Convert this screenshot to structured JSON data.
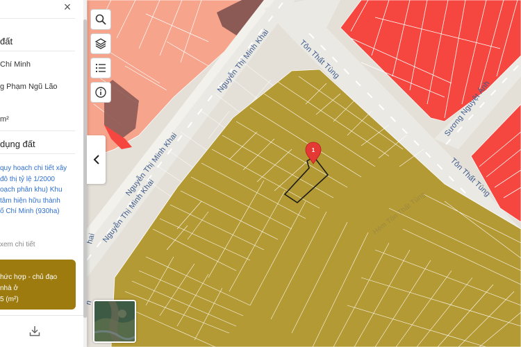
{
  "panel": {
    "close_symbol": "×",
    "section_heading_1": "đất",
    "city_partial": "Chí Minh",
    "ward_partial": "g Phạm Ngũ Lão",
    "area_unit": "m²",
    "section_heading_2": "dụng đất",
    "plan_lines": [
      "quy hoạch chi tiết xây",
      "đô thị tỷ lệ 1/2000",
      "oạch phân khu) Khu",
      "tâm hiện hữu thành",
      "ố Chí Minh (930ha)"
    ],
    "details_link": "xem chi tiết",
    "zone_lines": [
      "hức hợp - chủ đạo",
      "nhà ở",
      "5 (m²)"
    ],
    "download_icon": "download-icon"
  },
  "toolbar": {
    "icons": [
      "search-icon",
      "layers-icon",
      "list-icon",
      "info-icon"
    ],
    "collapse_icon": "chevron-left-icon"
  },
  "map": {
    "marker_label": "1",
    "roads": {
      "nguyen_thi_minh_khai_top": "Nguyễn Thị Minh Khai",
      "nguyen_thi_minh_khai_mid": "Nguyễn Thị Minh Khai",
      "nguyen_thi_minh_khai_low": "Nguyễn Thị Minh Khai",
      "ton_that_tung_top": "Tôn Thất Tùng",
      "ton_that_tung_right": "Tôn Thất Tùng",
      "suong_nguyet_anh": "Sương Nguyệt Ánh",
      "edge_left": "hai",
      "edge_left_low": "n",
      "faint_mid": "Hẻm Tôn Thất Tùng"
    },
    "colors": {
      "residential_mixed": "#b49a34",
      "commercial_red": "#f5473f",
      "pink_zone": "#f7a48d",
      "brown_block": "#8b5a55",
      "road": "#e9e7e2",
      "marker": "#e53935"
    }
  }
}
